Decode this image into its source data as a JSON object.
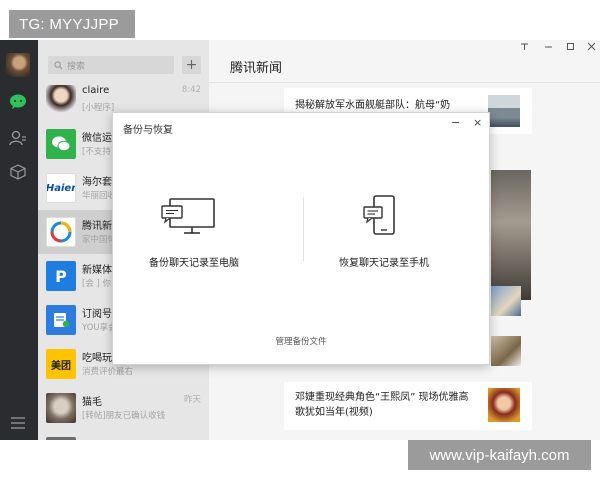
{
  "watermark_top": "TG: MYYJJPP",
  "watermark_bottom": "www.vip-kaifayh.com",
  "search": {
    "placeholder": "搜索",
    "icon": "search-icon"
  },
  "add_button": "+",
  "chats": [
    {
      "name": "claire",
      "preview": "[小程序]",
      "time": "8:42"
    },
    {
      "name": "微信运动",
      "preview": "[不支持]",
      "time": ""
    },
    {
      "name": "海尔套购",
      "preview": "华丽回收",
      "time": "",
      "logo": "Haier"
    },
    {
      "name": "腾讯新闻",
      "preview": "家中国体",
      "time": ""
    },
    {
      "name": "新媒体",
      "preview": "[会 ] 你",
      "time": "",
      "logo": "P"
    },
    {
      "name": "订阅号",
      "preview": "YOU享会",
      "time": ""
    },
    {
      "name": "吃喝玩乐",
      "preview": "消费评价最右",
      "time": "",
      "logo": "美团"
    },
    {
      "name": "猫毛",
      "preview": "[转帖]朋友已确认收钱",
      "time": "昨天"
    }
  ],
  "main": {
    "title": "腾讯新闻",
    "window_controls": [
      "pin-icon",
      "minimize-icon",
      "maximize-icon",
      "close-icon"
    ],
    "articles": [
      {
        "title": "揭秘解放军水面舰艇部队：航母“奶妈”海"
      },
      {
        "title": "邓婕重现经典角色“王熙凤” 现场优雅高歌犹如当年(视频)"
      }
    ]
  },
  "dialog": {
    "title": "备份与恢复",
    "minimize": "−",
    "close": "×",
    "backup_label": "备份聊天记录至电脑",
    "restore_label": "恢复聊天记录至手机",
    "manage_label": "管理备份文件"
  }
}
